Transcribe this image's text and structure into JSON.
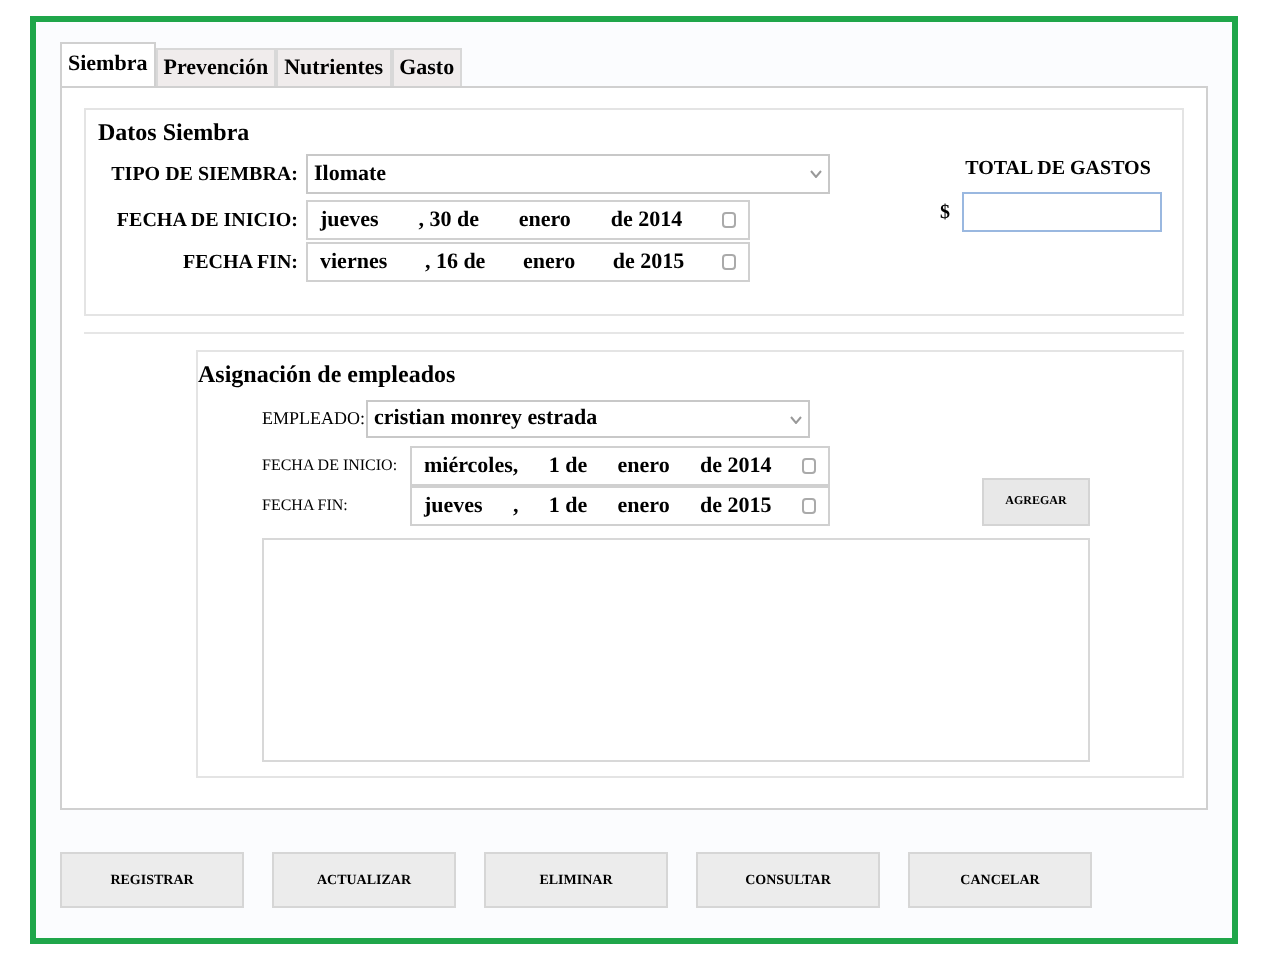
{
  "tabs": [
    {
      "label": "Siembra",
      "selected": true
    },
    {
      "label": "Prevención",
      "selected": false
    },
    {
      "label": "Nutrientes",
      "selected": false
    },
    {
      "label": "Gasto",
      "selected": false
    }
  ],
  "datos_siembra": {
    "title": "Datos Siembra",
    "tipo": {
      "label": "TIPO DE SIEMBRA:",
      "value": "Ilomate"
    },
    "fecha_inicio": {
      "label": "FECHA DE INICIO:",
      "parts": [
        "jueves",
        ", 30 de",
        "enero",
        "de 2014"
      ]
    },
    "fecha_fin": {
      "label": "FECHA FIN:",
      "parts": [
        "viernes",
        ", 16 de",
        "enero",
        "de 2015"
      ]
    },
    "total": {
      "label": "TOTAL DE GASTOS",
      "currency": "$"
    }
  },
  "asignacion": {
    "title": "Asignación de empleados",
    "empleado": {
      "label": "EMPLEADO:",
      "value": "cristian monrey estrada"
    },
    "fecha_inicio": {
      "label": "FECHA DE INICIO:",
      "parts": [
        "miércoles,",
        "1 de",
        "enero",
        "de 2014"
      ]
    },
    "fecha_fin": {
      "label": "FECHA FIN:",
      "parts": [
        "jueves",
        ",",
        "1 de",
        "enero",
        "de 2015"
      ]
    },
    "add_button": "AGREGAR"
  },
  "buttons": [
    "REGISTRAR",
    "ACTUALIZAR",
    "ELIMINAR",
    "CONSULTAR",
    "CANCELAR"
  ]
}
